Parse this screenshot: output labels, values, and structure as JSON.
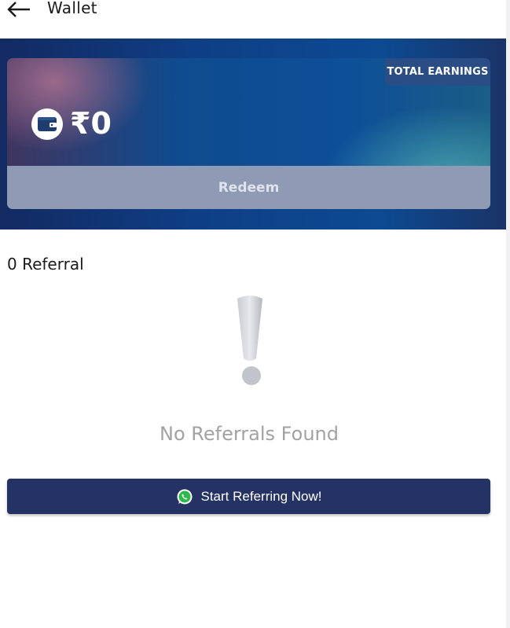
{
  "header": {
    "title": "Wallet",
    "back_icon": "arrow-left-icon"
  },
  "wallet_card": {
    "badge_label": "TOTAL EARNINGS",
    "wallet_icon": "wallet-icon",
    "amount": "₹0",
    "redeem_label": "Redeem"
  },
  "referrals": {
    "count_label": "0 Referral",
    "empty_icon": "exclamation-icon",
    "empty_message": "No Referrals Found",
    "cta_label": "Start Referring Now!",
    "cta_icon": "whatsapp-icon"
  },
  "colors": {
    "primary": "#243264",
    "banner": "#0e3f86",
    "redeem_bg": "#8f9ab4",
    "empty_text": "#a2a2a2"
  }
}
